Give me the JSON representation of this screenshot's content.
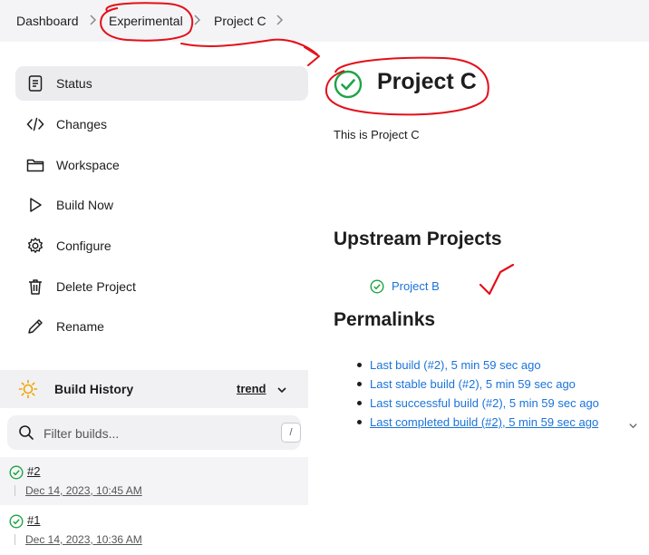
{
  "breadcrumb": [
    "Dashboard",
    "Experimental",
    "Project C"
  ],
  "sidebar": {
    "items": [
      {
        "label": "Status",
        "icon": "document-icon"
      },
      {
        "label": "Changes",
        "icon": "code-icon"
      },
      {
        "label": "Workspace",
        "icon": "folder-icon"
      },
      {
        "label": "Build Now",
        "icon": "play-icon"
      },
      {
        "label": "Configure",
        "icon": "gear-icon"
      },
      {
        "label": "Delete Project",
        "icon": "trash-icon"
      },
      {
        "label": "Rename",
        "icon": "pencil-icon"
      }
    ]
  },
  "build_history": {
    "title": "Build History",
    "trend_label": "trend",
    "filter_placeholder": "Filter builds...",
    "shortcut": "/",
    "builds": [
      {
        "number": "#2",
        "date": "Dec 14, 2023, 10:45 AM"
      },
      {
        "number": "#1",
        "date": "Dec 14, 2023, 10:36 AM"
      }
    ]
  },
  "main": {
    "title": "Project C",
    "description": "This is Project C",
    "upstream_heading": "Upstream Projects",
    "upstream_projects": [
      "Project B"
    ],
    "permalinks_heading": "Permalinks",
    "permalinks": [
      "Last build (#2), 5 min 59 sec ago",
      "Last stable build (#2), 5 min 59 sec ago",
      "Last successful build (#2), 5 min 59 sec ago",
      "Last completed build (#2), 5 min 59 sec ago"
    ]
  },
  "colors": {
    "success": "#1ea446",
    "link": "#1a73d9",
    "annotation": "#e3101a"
  }
}
